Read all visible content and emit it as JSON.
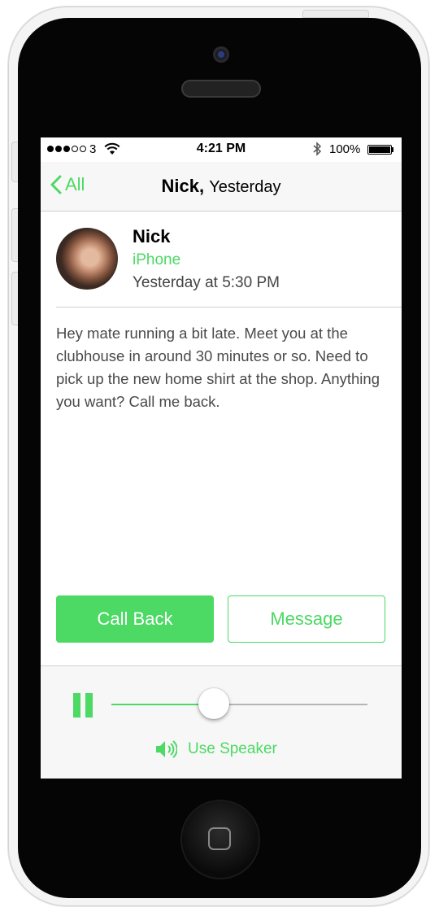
{
  "status_bar": {
    "signal_bars_filled": 3,
    "signal_bars_total": 5,
    "carrier": "3",
    "time": "4:21 PM",
    "battery": "100%"
  },
  "navbar": {
    "back_label": "All",
    "title_name": "Nick,",
    "title_sub": "Yesterday"
  },
  "contact": {
    "name": "Nick",
    "device": "iPhone",
    "timestamp": "Yesterday at 5:30 PM"
  },
  "message": "Hey mate running a bit late. Meet you at the clubhouse in around 30 minutes or so. Need to pick up the new home shirt at the shop. Anything you want? Call me back.",
  "actions": {
    "call_back": "Call Back",
    "message": "Message"
  },
  "player": {
    "progress": 0.4,
    "speaker_label": "Use Speaker"
  },
  "colors": {
    "accent": "#4cd964",
    "text": "#000000",
    "secondary_text": "#4a4a4a"
  },
  "icons": [
    "chevron-left-icon",
    "wifi-icon",
    "bluetooth-icon",
    "battery-icon",
    "pause-icon",
    "speaker-icon",
    "home-button-icon",
    "camera-icon"
  ]
}
